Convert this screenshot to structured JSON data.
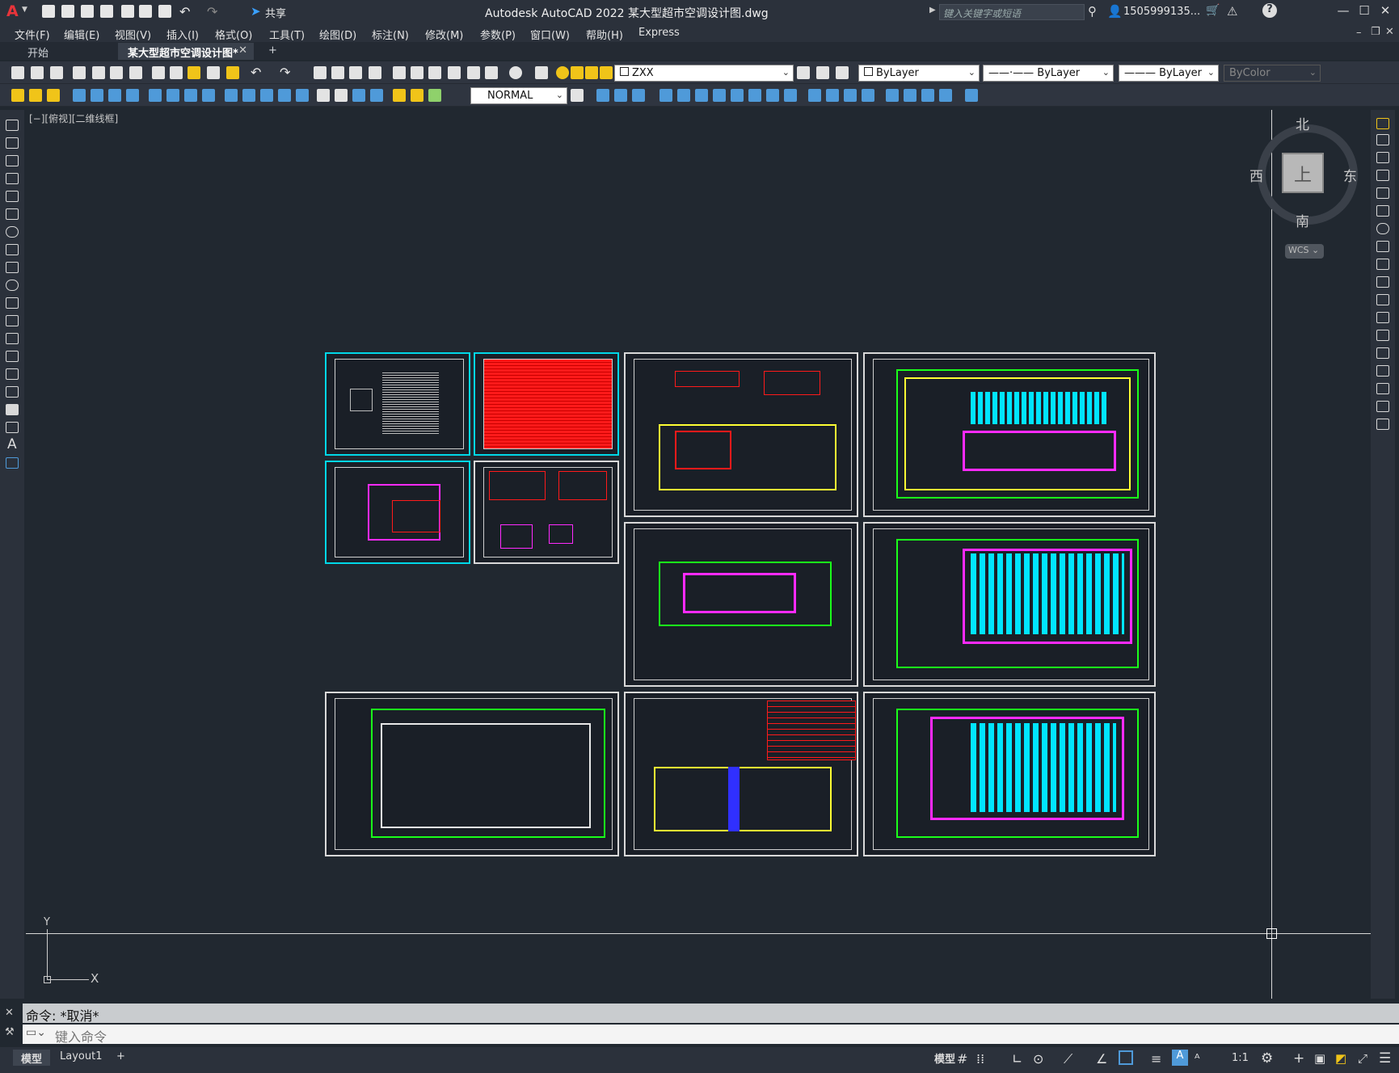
{
  "window": {
    "title": "Autodesk AutoCAD 2022    某大型超市空调设计图.dwg",
    "share_label": "共享",
    "search_placeholder": "键入关键字或短语",
    "user": "1505999135...",
    "minimize": "—",
    "restore": "☐",
    "close": "✕"
  },
  "menu": [
    "文件(F)",
    "编辑(E)",
    "视图(V)",
    "插入(I)",
    "格式(O)",
    "工具(T)",
    "绘图(D)",
    "标注(N)",
    "修改(M)",
    "参数(P)",
    "窗口(W)",
    "帮助(H)",
    "Express"
  ],
  "tabs": {
    "start": "开始",
    "doc": "某大型超市空调设计图*",
    "add": "+"
  },
  "toolbar": {
    "layer": "ZXX",
    "color": "ByLayer",
    "linetype": "ByLayer",
    "lineweight": "ByLayer",
    "plotstyle": "ByColor",
    "dimstyle": "NORMAL"
  },
  "viewport": {
    "label": "[−][俯视][二维线框]"
  },
  "viewcube": {
    "north": "北",
    "south": "南",
    "east": "东",
    "west": "西",
    "face": "上",
    "wcs": "WCS"
  },
  "ucs": {
    "x": "X",
    "y": "Y"
  },
  "command": {
    "history": "命令: *取消*",
    "placeholder": "键入命令"
  },
  "status": {
    "model": "模型",
    "layout1": "Layout1",
    "add": "+",
    "mode": "模型",
    "scale": "1:1"
  },
  "colors": {
    "accent": "#00d8e8",
    "red": "#ff1a1a",
    "cyan": "#00e5ff",
    "green": "#1aff1a",
    "magenta": "#ff2aff",
    "yellow": "#ffff33"
  }
}
